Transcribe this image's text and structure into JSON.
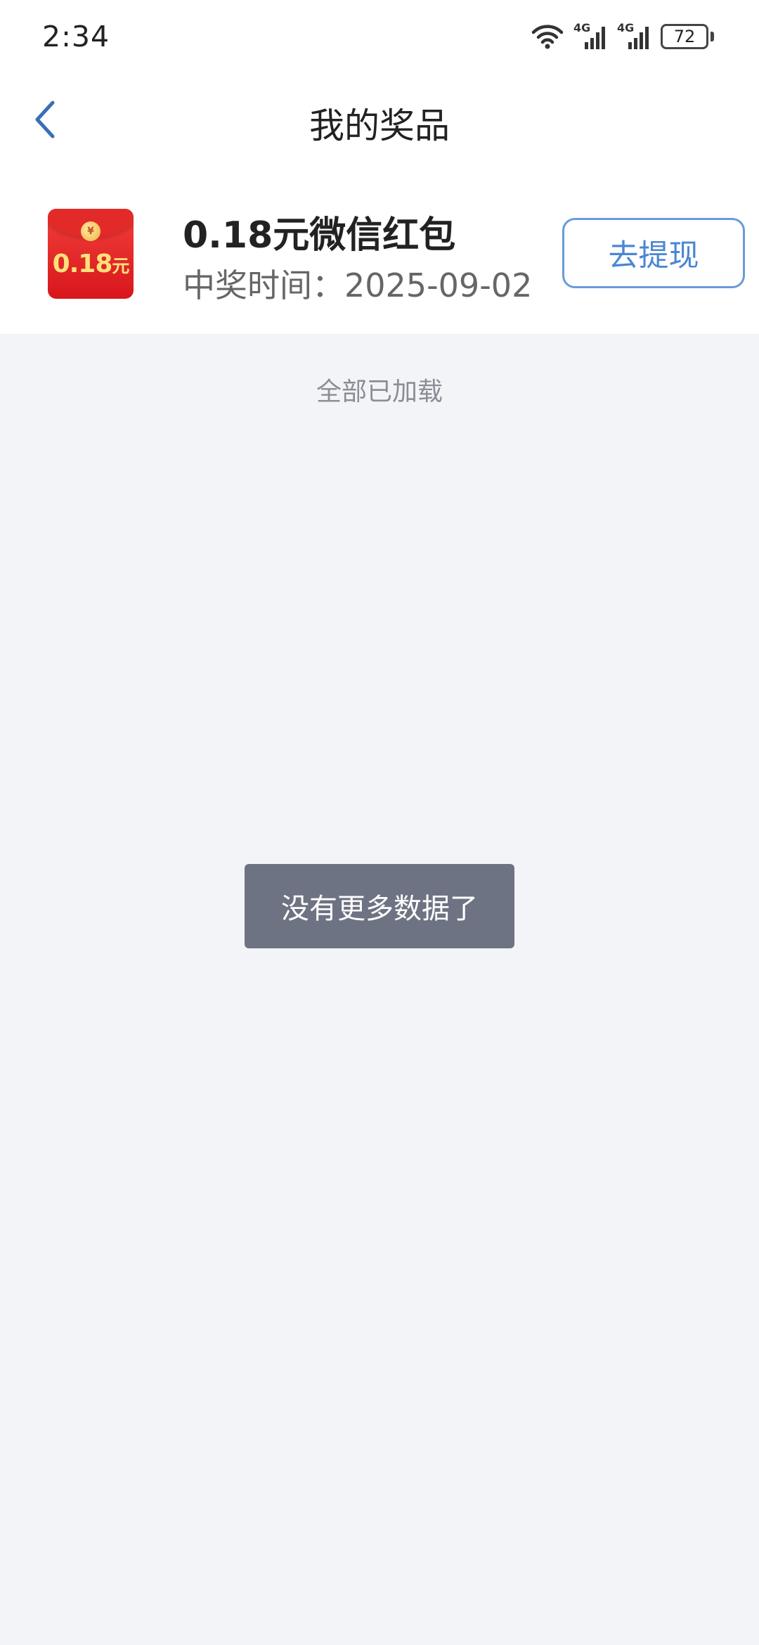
{
  "status_bar": {
    "time": "2:34",
    "network_1": "4G",
    "network_2": "4G",
    "battery": "72"
  },
  "nav": {
    "title": "我的奖品",
    "back_icon": "chevron-left-icon"
  },
  "prize": {
    "icon_amount": "0.18",
    "icon_unit": "元",
    "icon_coin": "¥",
    "name": "0.18元微信红包",
    "time_label": "中奖时间：",
    "time_value": "2025-09-02",
    "action_label": "去提现"
  },
  "list": {
    "end_text": "全部已加载"
  },
  "toast": {
    "message": "没有更多数据了"
  },
  "colors": {
    "accent": "#4a86d4",
    "background": "#f3f4f7",
    "toast_bg": "#6e7383"
  }
}
